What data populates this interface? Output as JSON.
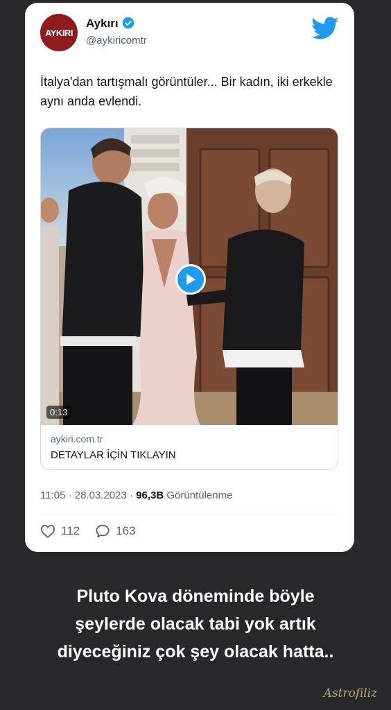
{
  "tweet": {
    "avatar_text": "AYKIRI",
    "display_name": "Aykırı",
    "handle": "@aykiricomtr",
    "text": "İtalya'dan tartışmalı görüntüler... Bir kadın, iki erkekle aynı anda evlendi.",
    "video_duration": "0:13",
    "link_domain": "aykiri.com.tr",
    "link_title": "DETAYLAR İÇİN TIKLAYIN",
    "time": "11:05 · 28.03.2023 · ",
    "views": "96,3B",
    "views_label": " Görüntülenme",
    "likes": "112",
    "replies": "163"
  },
  "caption": {
    "line1": "Pluto Kova döneminde böyle",
    "line2": "şeylerde olacak tabi yok artık",
    "line3": "diyeceğiniz çok şey olacak hatta.."
  },
  "watermark": "Astrofiliz",
  "colors": {
    "accent": "#1d9bf0",
    "brand": "#8e1b1f",
    "background": "#26282a"
  }
}
